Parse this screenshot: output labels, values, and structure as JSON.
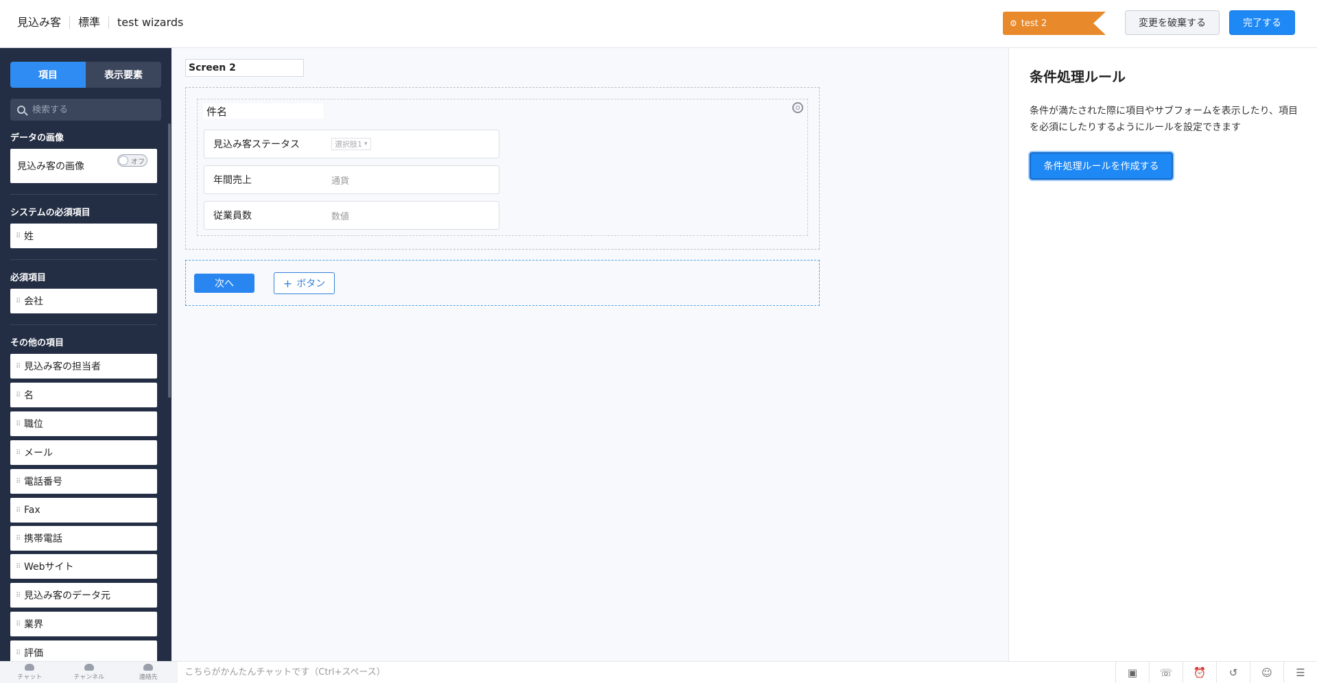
{
  "header": {
    "breadcrumb": [
      "見込み客",
      "標準",
      "test wizards"
    ],
    "tag_label": "test 2",
    "discard_label": "変更を破棄する",
    "done_label": "完了する"
  },
  "sidebar": {
    "tabs": [
      "項目",
      "表示要素"
    ],
    "search_placeholder": "検索する",
    "sections": {
      "image": {
        "title": "データの画像",
        "item": "見込み客の画像",
        "toggle_label": "オフ"
      },
      "system": {
        "title": "システムの必須項目",
        "items": [
          "姓"
        ]
      },
      "required": {
        "title": "必須項目",
        "items": [
          "会社"
        ]
      },
      "other": {
        "title": "その他の項目",
        "items": [
          "見込み客の担当者",
          "名",
          "職位",
          "メール",
          "電話番号",
          "Fax",
          "携帯電話",
          "Webサイト",
          "見込み客のデータ元",
          "業界",
          "評価"
        ]
      }
    }
  },
  "canvas": {
    "screen_name": "Screen 2",
    "section_name": "件名",
    "fields": [
      {
        "label": "見込み客ステータス",
        "value": "選択肢1"
      },
      {
        "label": "年間売上",
        "value": "通貨"
      },
      {
        "label": "従業員数",
        "value": "数値"
      }
    ],
    "next_label": "次へ",
    "add_button_label": "ボタン"
  },
  "right_panel": {
    "title": "条件処理ルール",
    "description": "条件が満たされた際に項目やサブフォームを表示したり、項目を必須にしたりするようにルールを設定できます",
    "create_label": "条件処理ルールを作成する"
  },
  "bottom_bar": {
    "nav": [
      "チャット",
      "チャンネル",
      "連絡先"
    ],
    "chat_placeholder": "こちらがかんたんチャットです（Ctrl+スペース）"
  }
}
